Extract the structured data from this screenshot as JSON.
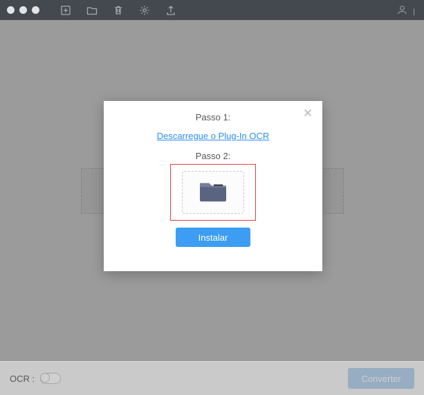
{
  "modal": {
    "step1_label": "Passo 1:",
    "download_link_text": "Descarregue o Plug-In OCR",
    "step2_label": "Passo 2:",
    "install_button": "Instalar"
  },
  "footer": {
    "ocr_label": "OCR :",
    "convert_button": "Converter"
  },
  "toolbar_icons": {
    "add": "add-file-icon",
    "folder": "folder-icon",
    "trash": "trash-icon",
    "settings": "gear-icon",
    "export": "export-icon",
    "account": "account-icon"
  },
  "colors": {
    "accent": "#3c9df2",
    "highlight_border": "#e53d3d",
    "titlebar": "#44484f"
  }
}
